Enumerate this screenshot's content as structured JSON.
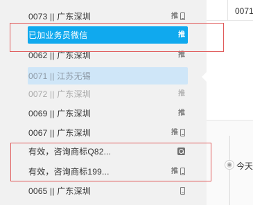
{
  "contacts": [
    {
      "label": "0073 || 广东深圳",
      "state": "normal",
      "tui": "推",
      "phone": true,
      "mag": false
    },
    {
      "label": "已加业务员微信",
      "state": "active",
      "tui": "推",
      "phone": false,
      "mag": false
    },
    {
      "label": "0062 || 广东深圳",
      "state": "normal",
      "tui": "推",
      "phone": false,
      "mag": false
    },
    {
      "label": "0071 || 江苏无锡",
      "state": "hover",
      "tui": "",
      "phone": false,
      "mag": false
    },
    {
      "label": "0072 || 广东深圳",
      "state": "dim",
      "tui": "推",
      "phone": false,
      "mag": false
    },
    {
      "label": "0069 || 广东深圳",
      "state": "normal",
      "tui": "推",
      "phone": false,
      "mag": false
    },
    {
      "label": "0067 || 广东深圳",
      "state": "normal",
      "tui": "推",
      "phone": true,
      "mag": false
    },
    {
      "label": "有效，咨询商标Q82...",
      "state": "normal",
      "tui": "",
      "phone": false,
      "mag": true
    },
    {
      "label": "有效，咨询商标199...",
      "state": "normal",
      "tui": "推",
      "phone": true,
      "mag": false
    },
    {
      "label": "0065 || 广东深圳",
      "state": "normal",
      "tui": "",
      "phone": true,
      "mag": false
    }
  ],
  "right_panel": {
    "top_value": "0071",
    "timeline_label": "今天"
  },
  "colors": {
    "active_bg": "#10a9ee",
    "hover_bg": "#cfe6f8",
    "list_bg": "#f1f1f1",
    "highlight_box": "#e05a5a"
  },
  "icons": {
    "push": "push-badge-icon",
    "phone": "mobile-phone-icon",
    "search": "magnifier-icon"
  }
}
